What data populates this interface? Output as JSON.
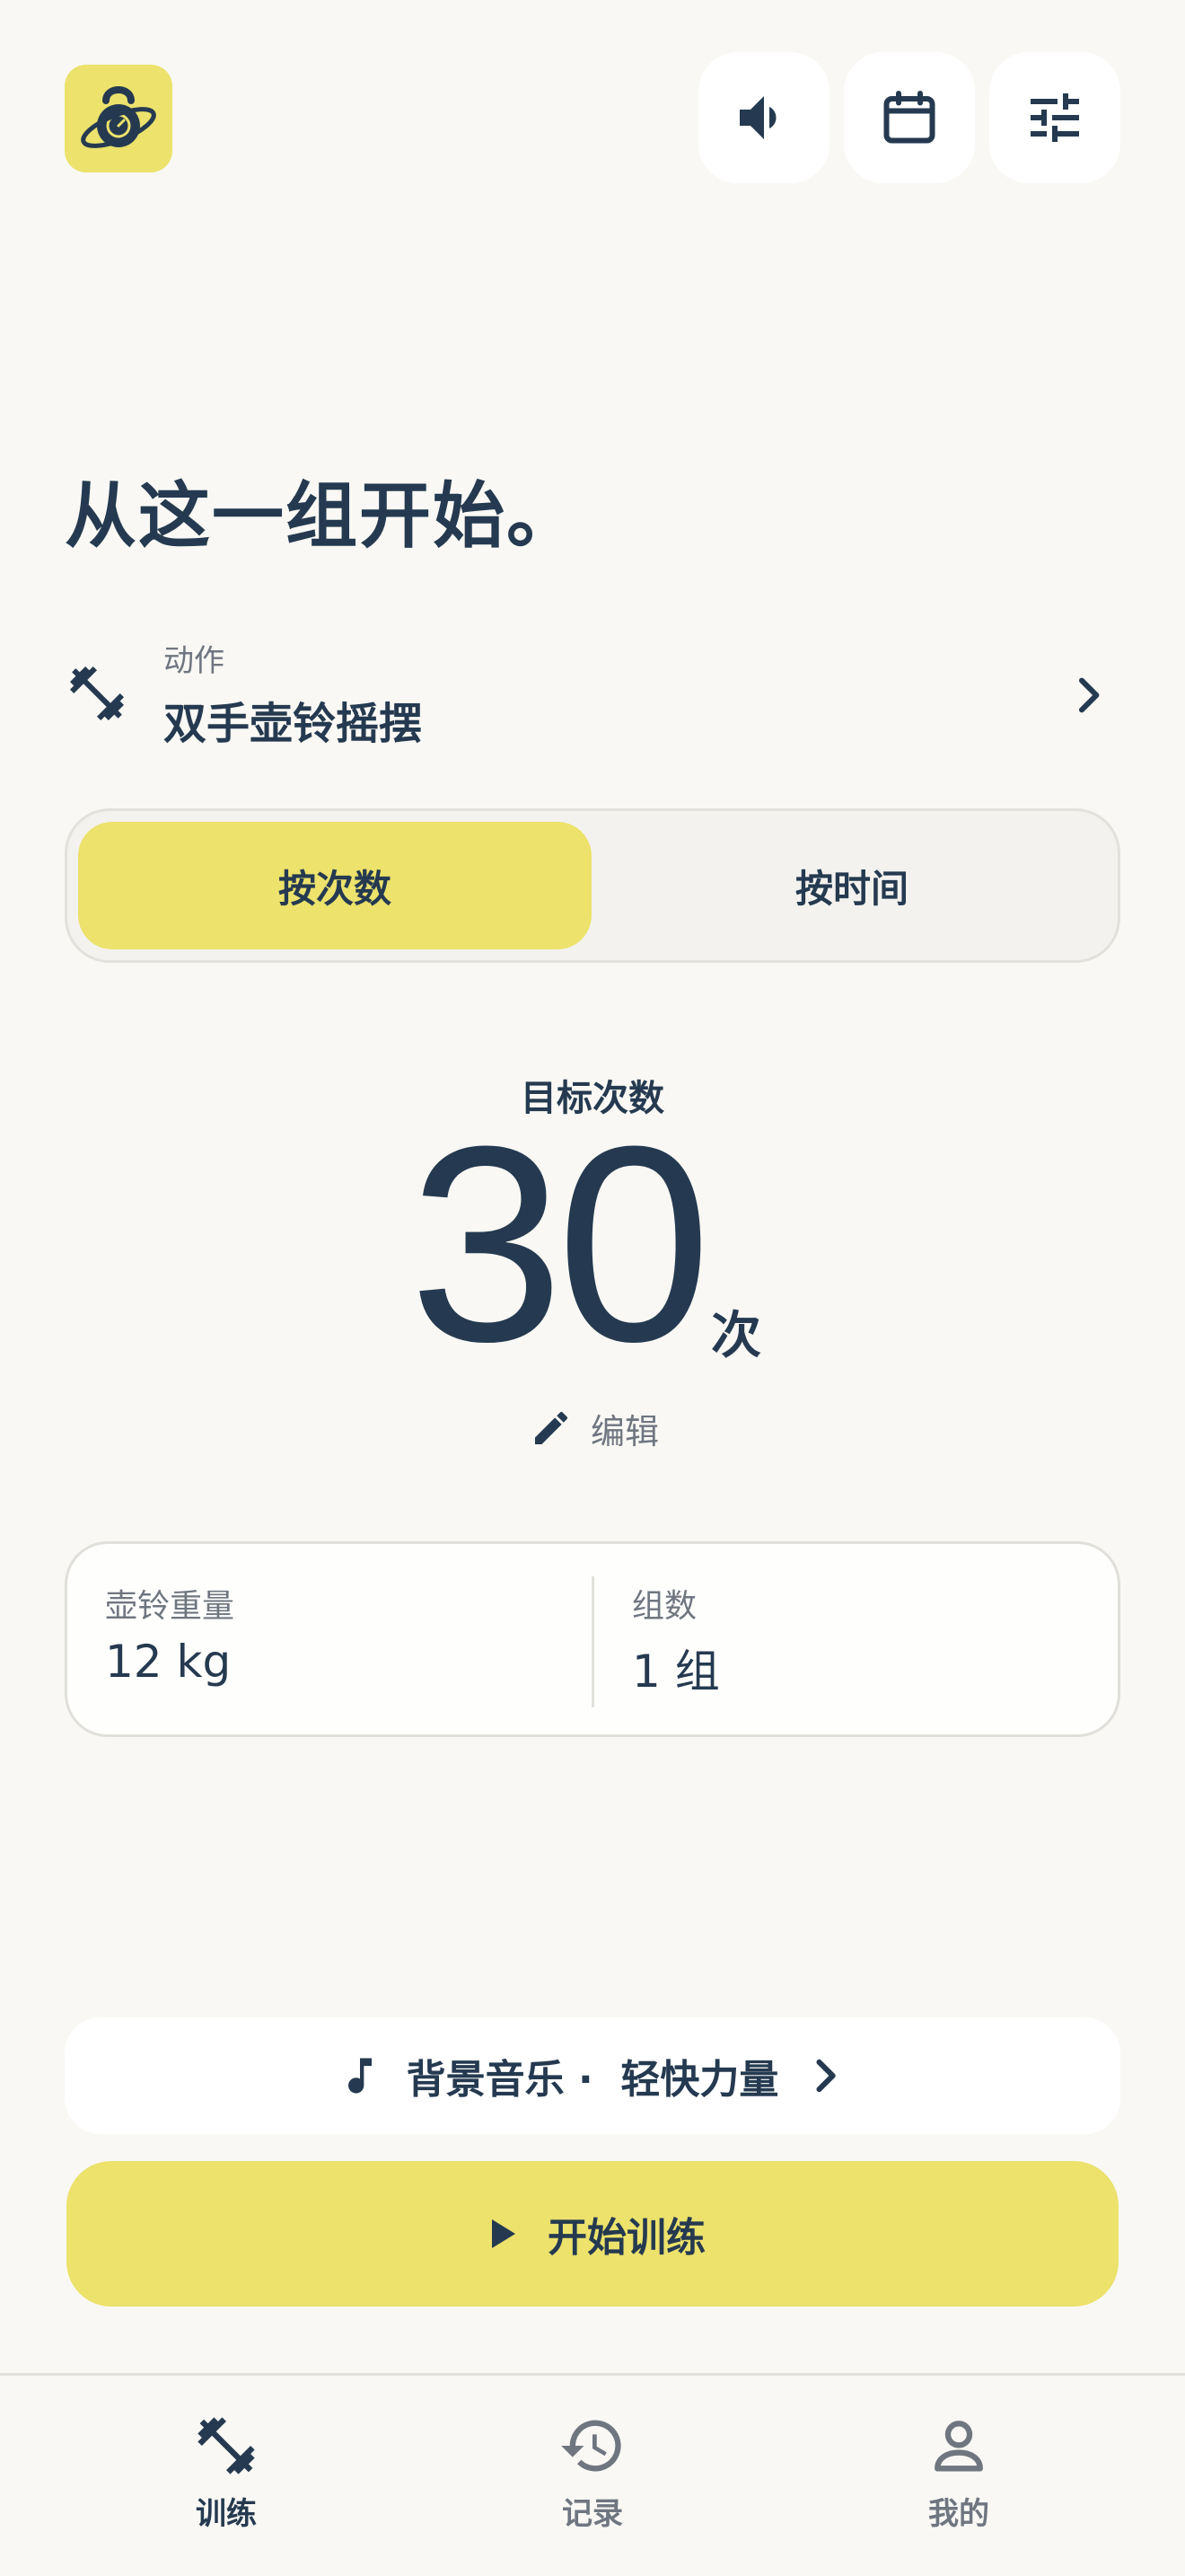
{
  "header": {
    "logo_icon": "kettlebell-planet-logo",
    "actions": [
      {
        "icon": "volume-icon",
        "name": "sound"
      },
      {
        "icon": "calendar-icon",
        "name": "calendar"
      },
      {
        "icon": "sliders-icon",
        "name": "settings"
      }
    ]
  },
  "page_title": "从这一组开始。",
  "exercise": {
    "icon": "dumbbell-icon",
    "label": "动作",
    "value": "双手壶铃摇摆"
  },
  "mode_toggle": {
    "options": [
      "按次数",
      "按时间"
    ],
    "selected": "按次数"
  },
  "target": {
    "label": "目标次数",
    "value": "30",
    "unit": "次",
    "edit_label": "编辑"
  },
  "params": {
    "weight_label": "壶铃重量",
    "weight_value": "12 kg",
    "sets_label": "组数",
    "sets_value": "1 组"
  },
  "music": {
    "text": "背景音乐 ·  轻快力量"
  },
  "start_button": {
    "label": "开始训练"
  },
  "bottom_nav": {
    "items": [
      {
        "label": "训练",
        "icon": "dumbbell-icon",
        "active": true
      },
      {
        "label": "记录",
        "icon": "history-icon",
        "active": false
      },
      {
        "label": "我的",
        "icon": "person-icon",
        "active": false
      }
    ]
  },
  "colors": {
    "accent": "#ece26c",
    "text_primary": "#253a50",
    "text_secondary": "#6f7680",
    "background": "#f9f8f4"
  }
}
